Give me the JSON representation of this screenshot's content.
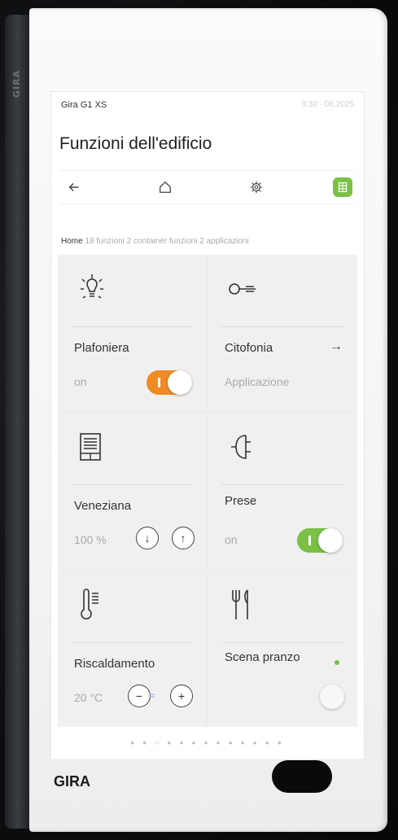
{
  "side_logo": "GIRA",
  "status": {
    "device_name": "Gira G1 XS",
    "clock": "9:30 · 06.2025"
  },
  "page_title": "Funzioni dell'edificio",
  "nav": {
    "back_icon": "arrow-left-icon",
    "home_icon": "home-icon",
    "settings_icon": "gear-icon",
    "grid_icon": "grid-icon",
    "active_color": "#79c044"
  },
  "breadcrumb": {
    "home": "Home",
    "rest": "18 funzioni 2 container funzioni 2 applicazioni"
  },
  "tiles": {
    "plafoniera": {
      "title": "Plafoniera",
      "state": "on",
      "toggle_color": "#f08a24",
      "on": true
    },
    "citofonia": {
      "title": "Citofonia",
      "sub": "Applicazione",
      "arrow": "→"
    },
    "veneziana": {
      "title": "Veneziana",
      "value": "100 %",
      "down": "↓",
      "up": "↑"
    },
    "prese": {
      "title": "Prese",
      "state": "on",
      "toggle_color": "#79c044",
      "on": true
    },
    "riscaldamento": {
      "title": "Riscaldamento",
      "value": "20 °C",
      "minus": "−",
      "plus": "+"
    },
    "scena": {
      "title": "Scena pranzo"
    }
  },
  "pager": "● ● ○ ● ● ● ● ● ● ● ● ● ●",
  "brand": "GIRA"
}
